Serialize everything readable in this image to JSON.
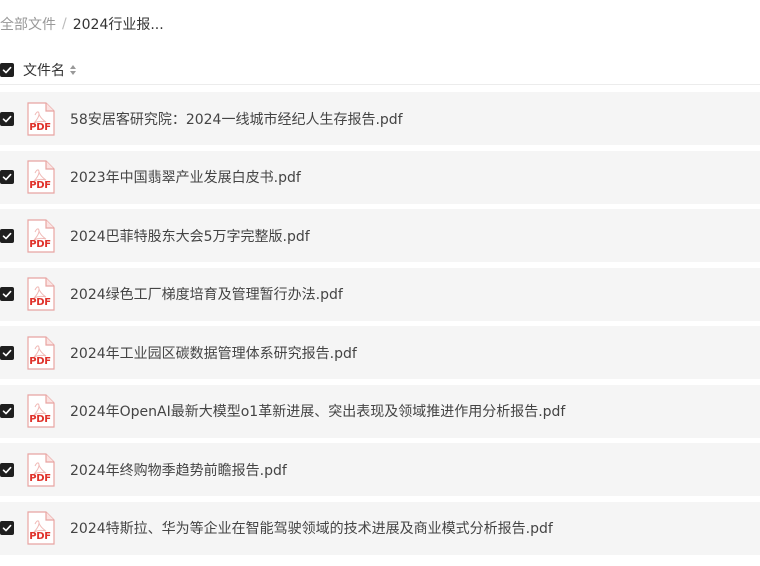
{
  "breadcrumb": {
    "root": "全部文件",
    "separator": "/",
    "current": "2024行业报..."
  },
  "header": {
    "column_label": "文件名",
    "sort_icon": "sort-caret-icon"
  },
  "colors": {
    "row_background": "#f5f5f5",
    "checkbox": "#1f1f1f",
    "pdf_red": "#e0322b"
  },
  "icons": {
    "file": "pdf-file-icon",
    "check": "checkmark-icon"
  },
  "files": [
    {
      "name": "58安居客研究院：2024一线城市经纪人生存报告.pdf",
      "type_label": "PDF",
      "checked": true
    },
    {
      "name": "2023年中国翡翠产业发展白皮书.pdf",
      "type_label": "PDF",
      "checked": true
    },
    {
      "name": "2024巴菲特股东大会5万字完整版.pdf",
      "type_label": "PDF",
      "checked": true
    },
    {
      "name": "2024绿色工厂梯度培育及管理暂行办法.pdf",
      "type_label": "PDF",
      "checked": true
    },
    {
      "name": "2024年工业园区碳数据管理体系研究报告.pdf",
      "type_label": "PDF",
      "checked": true
    },
    {
      "name": "2024年OpenAI最新大模型o1革新进展、突出表现及领域推进作用分析报告.pdf",
      "type_label": "PDF",
      "checked": true
    },
    {
      "name": "2024年终购物季趋势前瞻报告.pdf",
      "type_label": "PDF",
      "checked": true
    },
    {
      "name": "2024特斯拉、华为等企业在智能驾驶领域的技术进展及商业模式分析报告.pdf",
      "type_label": "PDF",
      "checked": true
    }
  ]
}
